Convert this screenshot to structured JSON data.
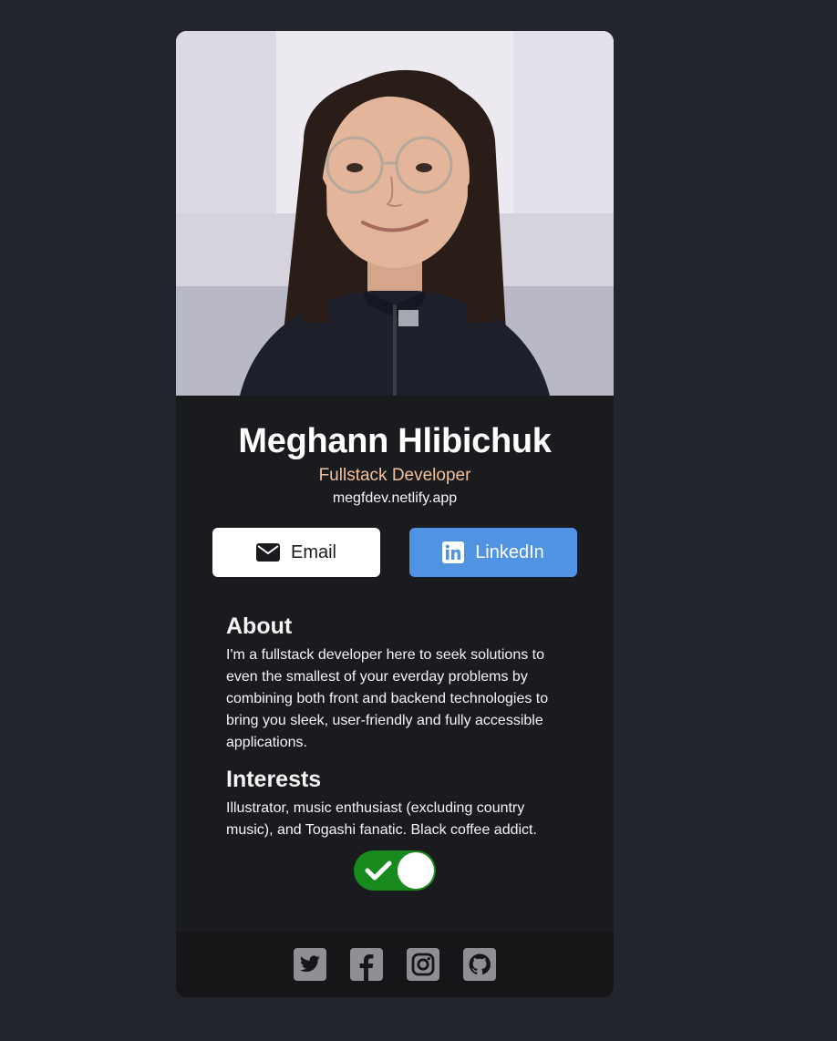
{
  "profile": {
    "name": "Meghann Hlibichuk",
    "title": "Fullstack Developer",
    "website": "megfdev.netlify.app",
    "photo_alt": "profile-photo"
  },
  "buttons": {
    "email_label": "Email",
    "linkedin_label": "LinkedIn"
  },
  "about": {
    "heading": "About",
    "text": "I'm a fullstack developer here to seek solutions to even the smallest of your everday problems by combining both front and backend technologies to bring you sleek, user-friendly and fully accessible applications."
  },
  "interests": {
    "heading": "Interests",
    "text": "Illustrator, music enthusiast (excluding country music), and Togashi fanatic. Black coffee addict."
  },
  "toggle": {
    "checked": true
  },
  "social": {
    "icons": [
      "twitter-icon",
      "facebook-icon",
      "instagram-icon",
      "github-icon"
    ]
  },
  "colors": {
    "page_background": "#23252c",
    "card_background": "#1a1b1f",
    "footer_background": "#161619",
    "title_accent": "#f3bf99",
    "linkedin_blue": "#5093e2",
    "toggle_green": "#188a1d",
    "social_icon_gray": "#8e8f95"
  }
}
